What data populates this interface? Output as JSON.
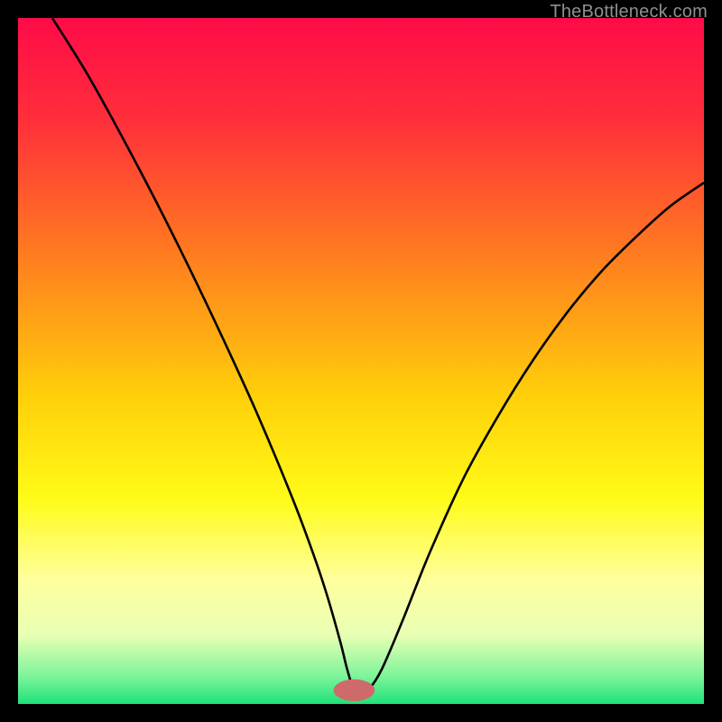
{
  "attribution": "TheBottleneck.com",
  "chart_data": {
    "type": "line",
    "title": "",
    "xlabel": "",
    "ylabel": "",
    "xlim": [
      0,
      100
    ],
    "ylim": [
      0,
      100
    ],
    "background_gradient": {
      "stops": [
        {
          "offset": 0,
          "color": "#ff0b48"
        },
        {
          "offset": 15,
          "color": "#ff2f3a"
        },
        {
          "offset": 35,
          "color": "#ff7e1f"
        },
        {
          "offset": 55,
          "color": "#ffcf0a"
        },
        {
          "offset": 70,
          "color": "#fffb17"
        },
        {
          "offset": 82,
          "color": "#ffff9e"
        },
        {
          "offset": 90,
          "color": "#e8ffb4"
        },
        {
          "offset": 96,
          "color": "#7cf49a"
        },
        {
          "offset": 100,
          "color": "#1fe27a"
        }
      ]
    },
    "marker": {
      "x": 49,
      "y": 2,
      "color": "#cf6a6a",
      "rx": 3,
      "ry": 1.6
    },
    "series": [
      {
        "name": "bottleneck-curve",
        "color": "#000000",
        "x": [
          5,
          10,
          15,
          20,
          25,
          30,
          35,
          40,
          43,
          45,
          47,
          48,
          49,
          50,
          51,
          53,
          56,
          60,
          65,
          70,
          75,
          80,
          85,
          90,
          95,
          100
        ],
        "y": [
          100,
          92,
          83,
          73.5,
          63.5,
          53,
          42,
          30,
          22,
          16,
          9,
          5,
          2,
          2,
          2,
          5,
          12,
          22,
          33,
          42,
          50,
          57,
          63,
          68,
          72.5,
          76
        ]
      }
    ]
  }
}
